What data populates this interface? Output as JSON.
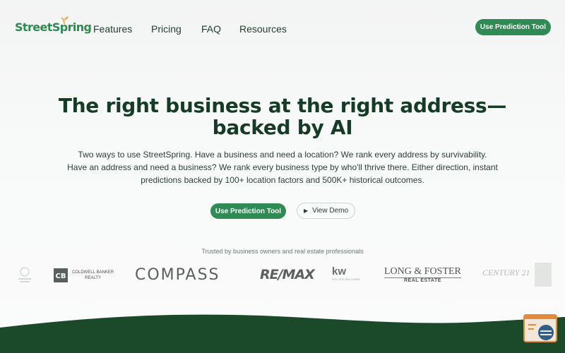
{
  "nav": {
    "logo": "StreetSpring",
    "links": [
      "Features",
      "Pricing",
      "FAQ",
      "Resources"
    ],
    "cta": "Use Prediction Tool"
  },
  "hero": {
    "title_lines": [
      "The right business at the right address—",
      "backed by AI"
    ],
    "subtitle_lines": [
      "Two ways to use StreetSpring. Have a business and need a location? We rank every address by survivability.",
      "Have an address and need a business? We rank every business type by who'll thrive there. Either direction, instant",
      "predictions backed by 100+ location factors and 500K+ historical outcomes."
    ],
    "primary_button": "Use Prediction Tool",
    "secondary_button": "View Demo"
  },
  "trusted": {
    "caption": "Trusted by business owners and real estate professionals",
    "logos": {
      "coldwell_line1": "COLDWELL BANKER",
      "coldwell_line2": "REALTY",
      "compass": "COMPASS",
      "remax": "RE/MAX",
      "kw": "kw",
      "kw_sub": "KELLER WILLIAMS",
      "longfoster_line1": "LONG & FOSTER",
      "longfoster_line2": "REAL ESTATE",
      "century21": "CENTURY 21"
    }
  },
  "colors": {
    "brand_green": "#2f8a53",
    "dark_green": "#163b28",
    "wave_green": "#1a4a2a",
    "widget_orange": "#e08a3a"
  }
}
